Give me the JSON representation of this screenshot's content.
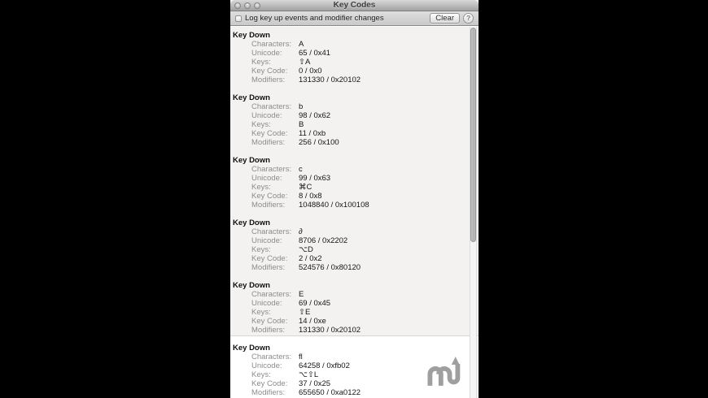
{
  "window": {
    "title": "Key Codes",
    "traffic_lights": {
      "close": "close",
      "minimize": "minimize",
      "zoom": "zoom"
    },
    "toolbar": {
      "checkbox_label": "Log key up events and modifier changes",
      "checkbox_checked": false,
      "clear_label": "Clear",
      "help_label": "?"
    }
  },
  "log": {
    "event_title": "Key Down",
    "field_labels": [
      "Characters:",
      "Unicode:",
      "Keys:",
      "Key Code:",
      "Modifiers:"
    ],
    "entries": [
      {
        "values": [
          "A",
          "65 / 0x41",
          "⇧A",
          "0 / 0x0",
          "131330 / 0x20102"
        ]
      },
      {
        "values": [
          "b",
          "98 / 0x62",
          "B",
          "11 / 0xb",
          "256 / 0x100"
        ]
      },
      {
        "values": [
          "c",
          "99 / 0x63",
          "⌘C",
          "8 / 0x8",
          "1048840 / 0x100108"
        ]
      },
      {
        "values": [
          "∂",
          "8706 / 0x2202",
          "⌥D",
          "2 / 0x2",
          "524576 / 0x80120"
        ]
      },
      {
        "values": [
          "E",
          "69 / 0x45",
          "⇧E",
          "14 / 0xe",
          "131330 / 0x20102"
        ]
      },
      {
        "values": [
          "ﬂ",
          "64258 / 0xfb02",
          "⌥⇧L",
          "37 / 0x25",
          "655650 / 0xa0122"
        ]
      }
    ]
  },
  "watermark": {
    "icon": "macupdate-logo",
    "color": "#8f8f8f"
  }
}
